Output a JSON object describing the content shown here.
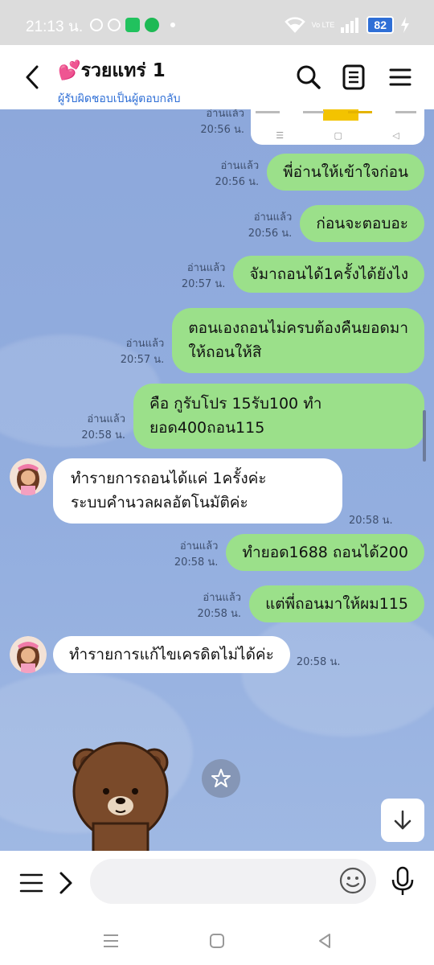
{
  "status_bar": {
    "time": "21:13 น.",
    "battery": "82",
    "network": "Vo LTE"
  },
  "header": {
    "title": "💕รวยแทร่ 1",
    "subtitle": "ผู้รับผิดชอบเป็นผู้ตอบกลับ"
  },
  "messages": [
    {
      "type": "out-image",
      "status": "อ่านแล้ว",
      "time": "20:56 น."
    },
    {
      "type": "out",
      "status": "อ่านแล้ว",
      "time": "20:56 น.",
      "text": "พี่อ่านให้เข้าใจก่อน"
    },
    {
      "type": "out",
      "status": "อ่านแล้ว",
      "time": "20:56 น.",
      "text": "ก่อนจะตอบอะ"
    },
    {
      "type": "out",
      "status": "อ่านแล้ว",
      "time": "20:57 น.",
      "text": "จัมาถอนได้1ครั้งได้ยังไง"
    },
    {
      "type": "out",
      "status": "อ่านแล้ว",
      "time": "20:57 น.",
      "line1": "ตอนเองถอนไม่ครบต้องคืนยอดมา",
      "line2": "ให้ถอนให้สิ"
    },
    {
      "type": "out",
      "status": "อ่านแล้ว",
      "time": "20:58 น.",
      "line1": "คือ กูรับโปร 15รับ100 ทำ",
      "line2": "ยอด400ถอน115"
    },
    {
      "type": "in",
      "time": "20:58 น.",
      "line1": "ทำรายการถอนได้แค่ 1ครั้งค่ะ",
      "line2": "ระบบคำนวลผลอัตโนมัติค่ะ"
    },
    {
      "type": "out",
      "status": "อ่านแล้ว",
      "time": "20:58 น.",
      "text": "ทำยอด1688 ถอนได้200"
    },
    {
      "type": "out",
      "status": "อ่านแล้ว",
      "time": "20:58 น.",
      "text": "แต่พี่ถอนมาให้ผม115"
    },
    {
      "type": "in",
      "time": "20:58 น.",
      "text": "ทำรายการแก้ไขเครดิตไม่ได้ค่ะ"
    }
  ],
  "input": {
    "placeholder": ""
  },
  "icons": {
    "back": "chevron-left-icon",
    "search": "search-icon",
    "notes": "notes-icon",
    "menu": "hamburger-icon",
    "star": "star-icon",
    "scroll_down": "arrow-down-icon",
    "emoji": "emoji-icon",
    "mic": "microphone-icon"
  },
  "colors": {
    "outgoing_bubble": "#9be08a",
    "incoming_bubble": "#ffffff",
    "chat_background": "#8fa9d9",
    "subtitle": "#2f6fd6"
  }
}
